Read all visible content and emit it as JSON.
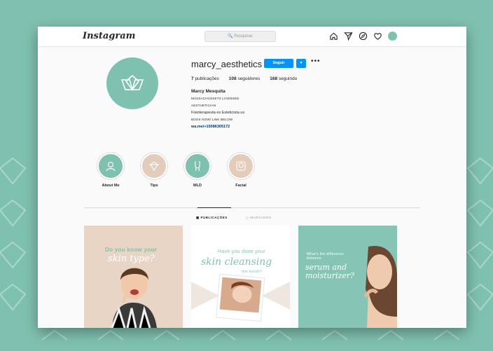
{
  "topbar": {
    "logo": "Instagram",
    "search_placeholder": "🔍 Pesquisar",
    "icons": [
      "home-icon",
      "direct-icon",
      "explore-icon",
      "heart-icon",
      "avatar"
    ]
  },
  "profile": {
    "username": "marcy_aesthetics",
    "follow_label": "Seguir",
    "more_label": "•••",
    "stats": {
      "posts": "7",
      "posts_label": "publicações",
      "followers": "108",
      "followers_label": "seguidores",
      "following": "168",
      "following_label": "seguindo"
    },
    "bio": {
      "name": "Marcy Mesquita",
      "line1": "MASSACHUSSETS LICENSED",
      "line2": "AESTHETICIAN",
      "line3": "Fisioterapeuta ex Esteticista us",
      "line4": "BOOK NOW/ LINK BELOW",
      "link": "wa.me/+15086305172"
    }
  },
  "highlights": [
    {
      "label": "About Me",
      "style": "green",
      "icon": "person-icon"
    },
    {
      "label": "Tips",
      "style": "beige",
      "icon": "flower-icon"
    },
    {
      "label": "MLD",
      "style": "green",
      "icon": "body-icon"
    },
    {
      "label": "Facial",
      "style": "beige",
      "icon": "face-icon"
    }
  ],
  "tabs": {
    "posts": "PUBLICAÇÕES",
    "tagged": "MARCADOS"
  },
  "posts": [
    {
      "headline": "Do you know your",
      "script": "skin type?"
    },
    {
      "headline": "Have you done your",
      "script": "skin cleansing",
      "sub": "this month?"
    },
    {
      "headline": "What's the difference between",
      "script": "serum and moisturizer?"
    }
  ],
  "colors": {
    "accent": "#7fc1b0",
    "beige": "#e4ccbb",
    "button": "#0095f6"
  }
}
